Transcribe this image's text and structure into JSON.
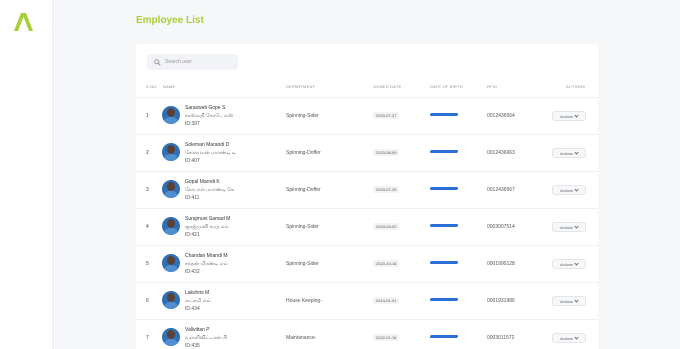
{
  "page": {
    "title": "Employee List"
  },
  "search": {
    "placeholder": "Search user"
  },
  "columns": {
    "sno": "S.NO",
    "name": "NAME",
    "department": "DEPARTMENT",
    "joined": "JOINED DATE",
    "dob": "DATE OF BIRTH",
    "rfid": "RFID",
    "actions": "ACTIONS"
  },
  "rows": [
    {
      "sno": "1",
      "name": "Saraswati Gope S",
      "native": "சரஸ்வதி கோபே எஸ்",
      "id": "ID:397",
      "department": "Spinning-Sider",
      "joined": "2023-07-27",
      "rfid": "0012436564",
      "action": "Actions"
    },
    {
      "sno": "2",
      "name": "Soleman Marandi D",
      "native": "சோலமான் மராண்டி டி",
      "id": "ID:407",
      "department": "Spinning-Doffer",
      "joined": "2023-08-09",
      "rfid": "0012436663",
      "action": "Actions"
    },
    {
      "sno": "3",
      "name": "Gopal Marndi K",
      "native": "கோபால் மார்ண்டி கே",
      "id": "ID:411",
      "department": "Spinning-Doffer",
      "joined": "2023-07-25",
      "rfid": "0012436567",
      "action": "Actions"
    },
    {
      "sno": "4",
      "name": "Surajmuni Samad M",
      "native": "சூரஜ்முனி சமத் எம்",
      "id": "ID:421",
      "department": "Spinning-Sider",
      "joined": "2023-03-02",
      "rfid": "0003007514",
      "action": "Actions"
    },
    {
      "sno": "5",
      "name": "Chandan Mrandi M",
      "native": "சந்தன் மிரண்டி எம்",
      "id": "ID:432",
      "department": "Spinning-Sider",
      "joined": "2023-10-16",
      "rfid": "0001990128",
      "action": "Actions"
    },
    {
      "sno": "6",
      "name": "Lakshmi M",
      "native": "லட்சுமி எம்",
      "id": "ID:434",
      "department": "House Keeping-",
      "joined": "2014-01-01",
      "rfid": "0001931986",
      "action": "Actions"
    },
    {
      "sno": "7",
      "name": "Vallvittan P",
      "native": "வள்ளிவிட்டான் பி",
      "id": "ID:435",
      "department": "Maintanance-",
      "joined": "2022-01-16",
      "rfid": "0003011572",
      "action": "Actions"
    }
  ]
}
